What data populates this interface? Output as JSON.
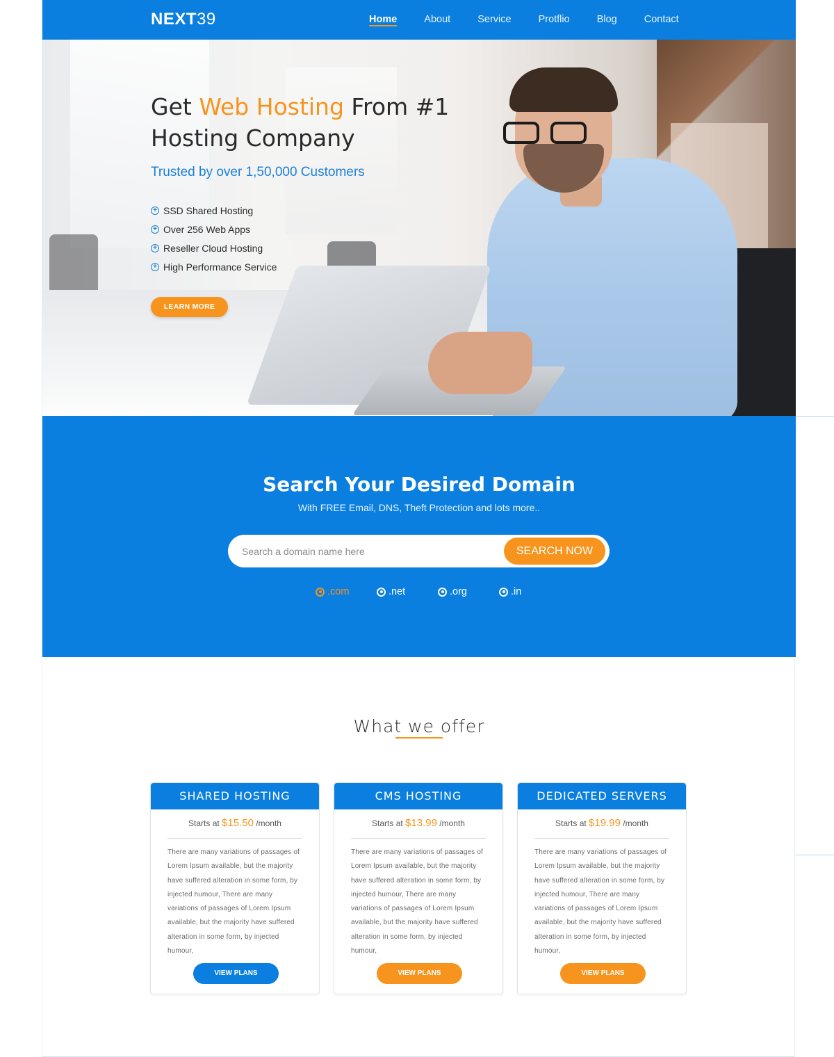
{
  "nav": {
    "logo_bold": "NEXT",
    "logo_light": "39",
    "items": [
      "Home",
      "About",
      "Service",
      "Protflio",
      "Blog",
      "Contact"
    ],
    "active": "Home"
  },
  "hero": {
    "title_pre": "Get ",
    "title_highlight": "Web Hosting",
    "title_post": " From #1 Hosting Company",
    "subtitle": "Trusted by over 1,50,000 Customers",
    "features": [
      "SSD Shared Hosting",
      "Over 256 Web Apps",
      "Reseller Cloud Hosting",
      "High Performance Service"
    ],
    "cta": "LEARN MORE"
  },
  "domain": {
    "title": "Search Your Desired Domain",
    "subtitle": "With FREE Email, DNS, Theft Protection and lots more..",
    "search_placeholder": "Search a domain name here",
    "search_button": "SEARCH NOW",
    "tlds": [
      ".com",
      ".net",
      ".org",
      ".in"
    ],
    "selected_tld": ".com"
  },
  "offer": {
    "title": "What we offer",
    "cards": [
      {
        "name": "SHARED HOSTING",
        "starts_prefix": "Starts at",
        "price": "$15.50",
        "period": "/month",
        "desc": "There are many variations of passages of Lorem Ipsum available, but the majority have suffered alteration in some form, by injected humour, There are many variations of passages of Lorem Ipsum available, but the majority have suffered alteration in some form, by injected humour,",
        "button": "VIEW PLANS",
        "button_color": "#0a7fe0"
      },
      {
        "name": "CMS HOSTING",
        "starts_prefix": "Starts at",
        "price": "$13.99",
        "period": "/month",
        "desc": "There are many variations of passages of Lorem Ipsum available, but the majority have suffered alteration in some form, by injected humour, There are many variations of passages of Lorem Ipsum available, but the majority have suffered alteration in some form, by injected humour,",
        "button": "VIEW PLANS",
        "button_color": "#f7941d"
      },
      {
        "name": "DEDICATED SERVERS",
        "starts_prefix": "Starts at",
        "price": "$19.99",
        "period": "/month",
        "desc": "There are many variations of passages of Lorem Ipsum available, but the majority have suffered alteration in some form, by injected humour, There are many variations of passages of Lorem Ipsum available, but the majority have suffered alteration in some form, by injected humour,",
        "button": "VIEW PLANS",
        "button_color": "#f7941d"
      }
    ]
  },
  "colors": {
    "primary_blue": "#0a7fe0",
    "accent_orange": "#f7941d",
    "text_dark": "#2a2a2a"
  }
}
